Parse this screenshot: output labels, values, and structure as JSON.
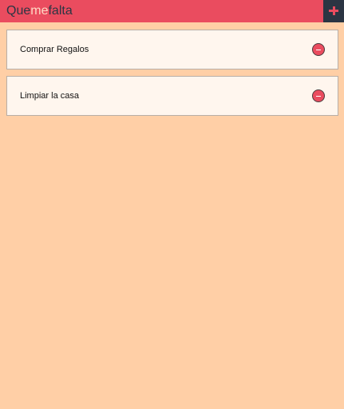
{
  "app": {
    "title_part1": "Que",
    "title_part2": "me",
    "title_part3": "falta",
    "accent_color": "#ea4c5f",
    "dark_color": "#2b3543",
    "background_color": "#ffcfa6"
  },
  "header": {
    "add_icon": "plus-icon"
  },
  "tasks": [
    {
      "label": "Comprar Regalos",
      "remove_icon": "minus-circle-icon"
    },
    {
      "label": "Limpiar la casa",
      "remove_icon": "minus-circle-icon"
    }
  ]
}
